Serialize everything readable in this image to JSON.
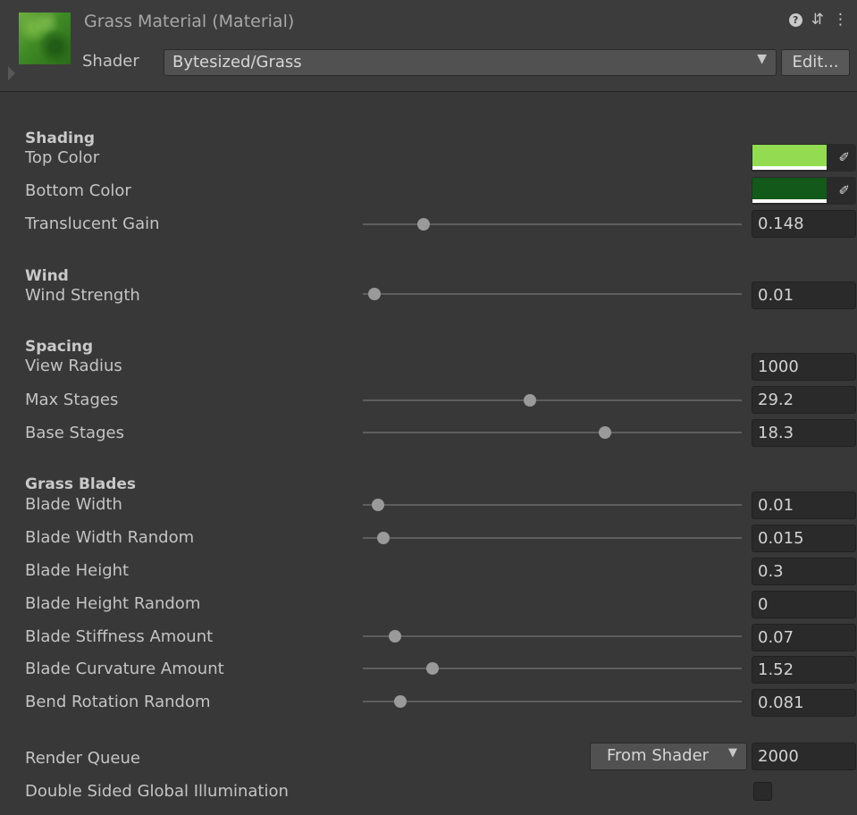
{
  "header": {
    "title": "Grass Material (Material)",
    "shader_label": "Shader",
    "shader_value": "Bytesized/Grass",
    "edit_label": "Edit...",
    "help_glyph": "?",
    "presets_glyph": "⇵",
    "menu_glyph": "⋮"
  },
  "sections": {
    "shading": "Shading",
    "wind": "Wind",
    "spacing": "Spacing",
    "grass_blades": "Grass Blades"
  },
  "colors": {
    "top_color": "#93dc52",
    "bottom_color": "#12591a"
  },
  "props": {
    "top_color": {
      "label": "Top Color"
    },
    "bottom_color": {
      "label": "Bottom Color"
    },
    "translucent_gain": {
      "label": "Translucent Gain",
      "value": "0.148",
      "slider": 0.16
    },
    "wind_strength": {
      "label": "Wind Strength",
      "value": "0.01",
      "slider": 0.03
    },
    "view_radius": {
      "label": "View Radius",
      "value": "1000"
    },
    "max_stages": {
      "label": "Max Stages",
      "value": "29.2",
      "slider": 0.44
    },
    "base_stages": {
      "label": "Base Stages",
      "value": "18.3",
      "slider": 0.64
    },
    "blade_width": {
      "label": "Blade Width",
      "value": "0.01",
      "slider": 0.04
    },
    "blade_width_random": {
      "label": "Blade Width Random",
      "value": "0.015",
      "slider": 0.055
    },
    "blade_height": {
      "label": "Blade Height",
      "value": "0.3"
    },
    "blade_height_random": {
      "label": "Blade Height Random",
      "value": "0"
    },
    "blade_stiffness": {
      "label": "Blade Stiffness Amount",
      "value": "0.07",
      "slider": 0.085
    },
    "blade_curvature": {
      "label": "Blade Curvature Amount",
      "value": "1.52",
      "slider": 0.185
    },
    "bend_rotation": {
      "label": "Bend Rotation Random",
      "value": "0.081",
      "slider": 0.1
    },
    "render_queue": {
      "label": "Render Queue",
      "mode": "From Shader",
      "value": "2000"
    },
    "double_sided_gi": {
      "label": "Double Sided Global Illumination",
      "checked": false
    }
  }
}
